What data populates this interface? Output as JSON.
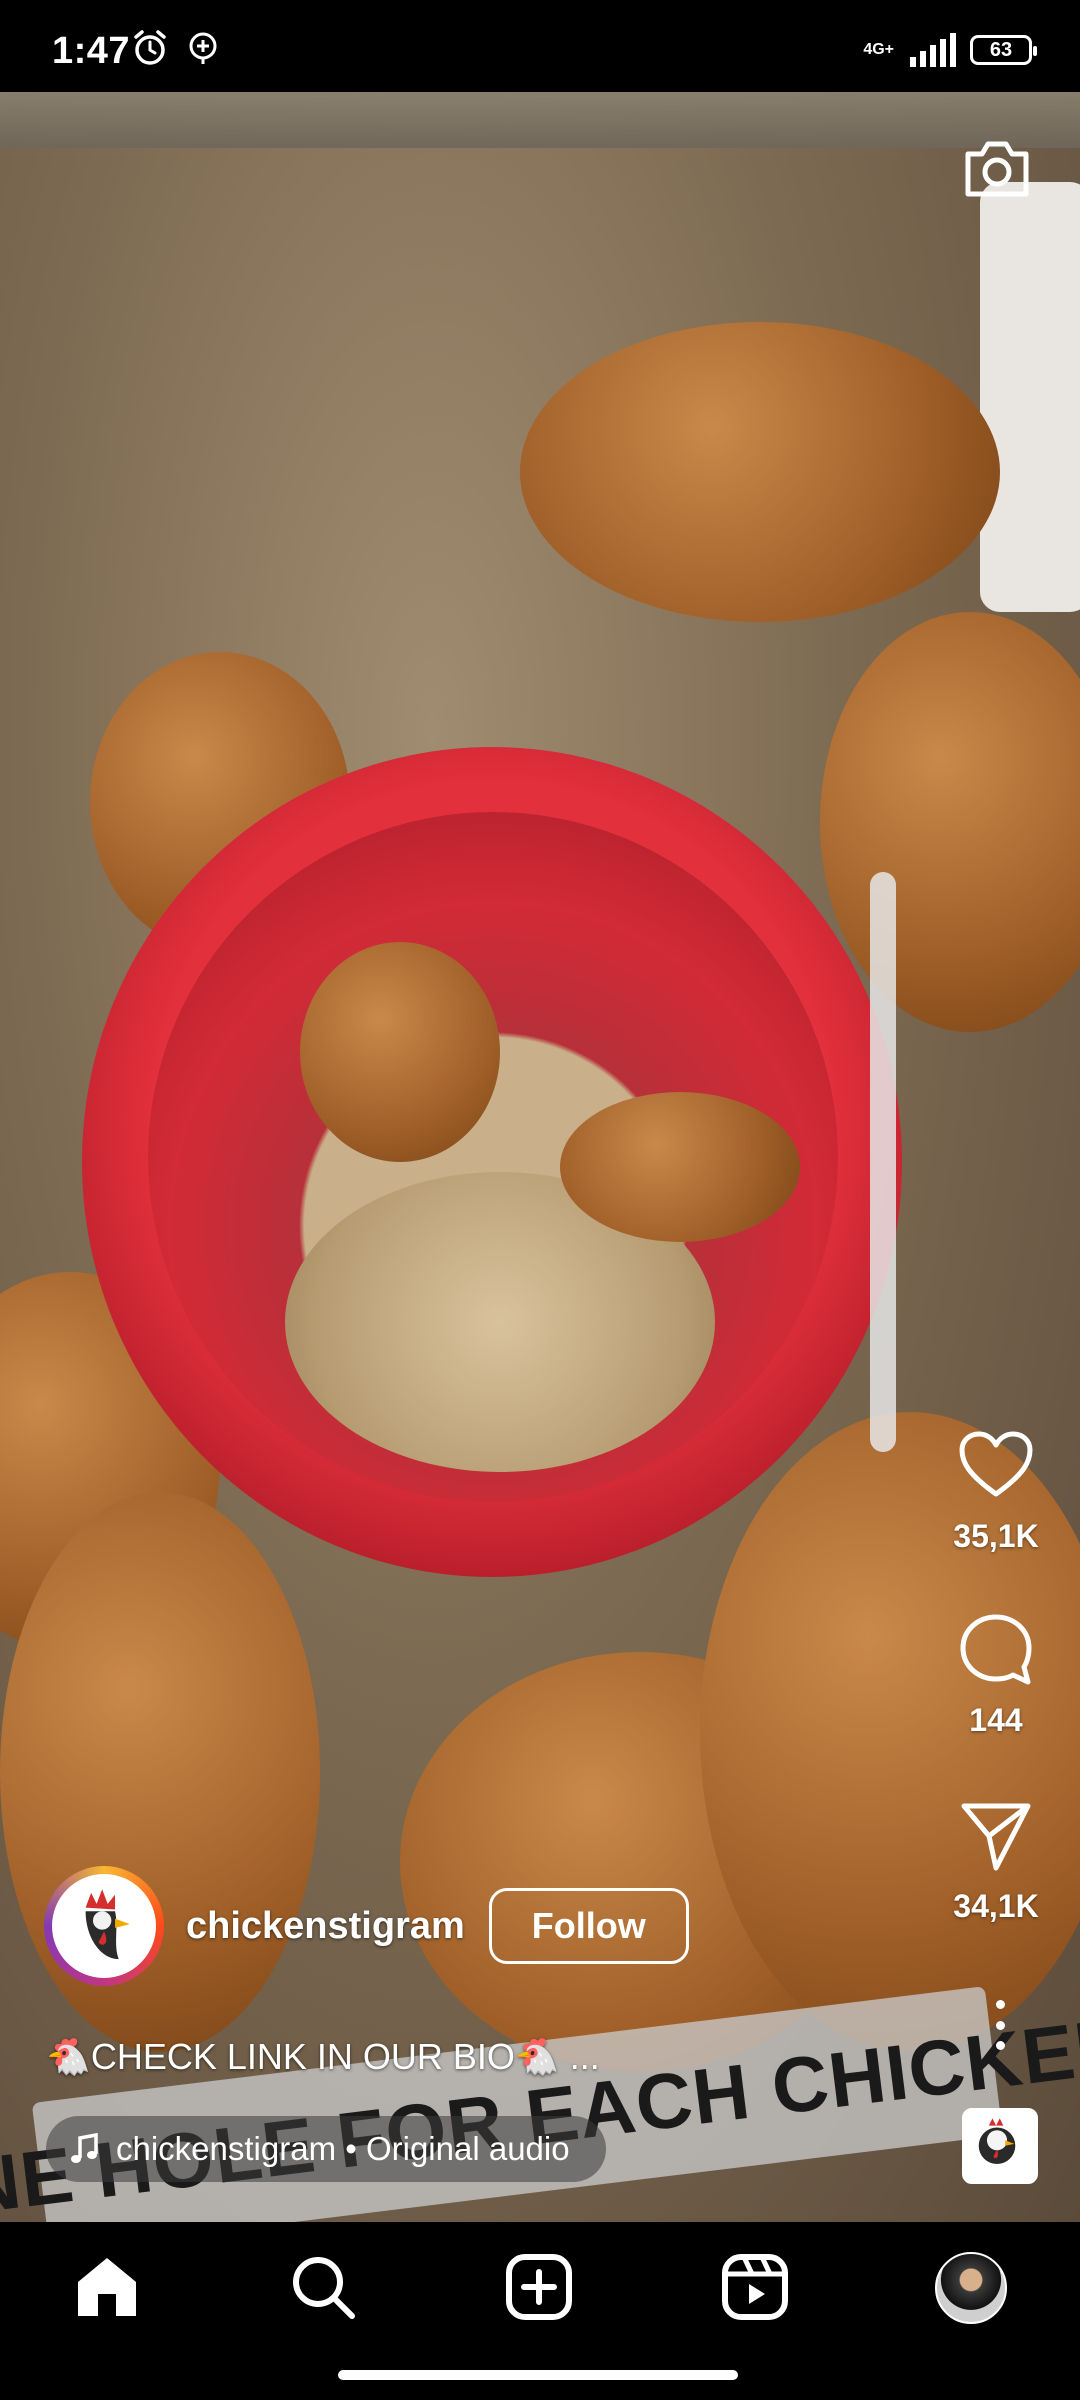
{
  "status_bar": {
    "time": "1:47",
    "network": "4G+",
    "battery": "63"
  },
  "video": {
    "overlay_text": "ONE HOLE FOR EACH CHICKEN"
  },
  "actions": {
    "likes": "35,1K",
    "comments": "144",
    "shares": "34,1K"
  },
  "author": {
    "username": "chickenstigram",
    "follow_label": "Follow"
  },
  "caption": "🐔CHECK LINK IN OUR BIO🐔 ...",
  "audio": {
    "label": "chickenstigram • Original audio"
  },
  "colors": {
    "accent": "#ffffff",
    "background": "#000000"
  },
  "icons": {
    "top": "camera-icon",
    "actions": [
      "heart-icon",
      "comment-icon",
      "share-icon",
      "more-icon"
    ],
    "nav": [
      "home-icon",
      "search-icon",
      "create-icon",
      "reels-icon",
      "profile-avatar"
    ]
  }
}
